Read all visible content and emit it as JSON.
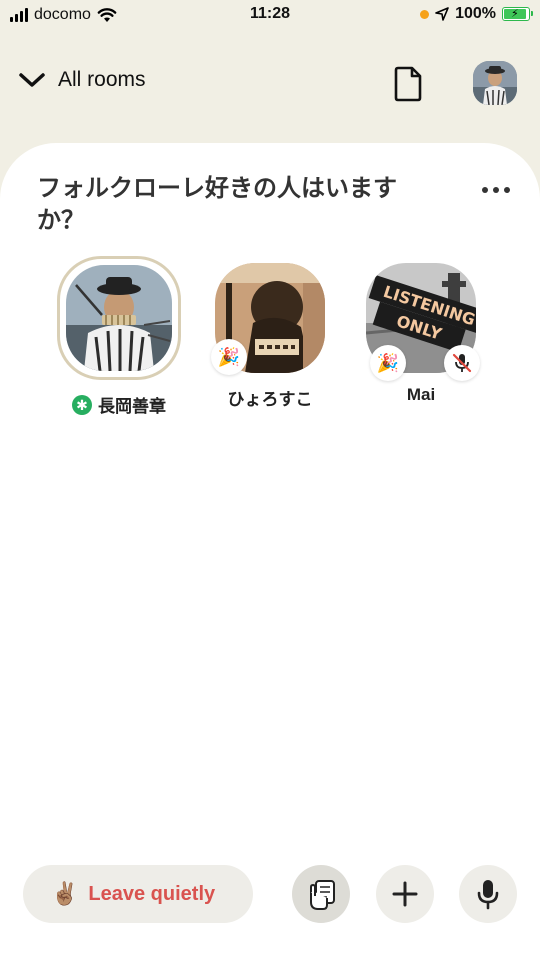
{
  "status_bar": {
    "carrier": "docomo",
    "time": "11:28",
    "battery": "100%"
  },
  "header": {
    "back_label": "All rooms",
    "icons": [
      "chevron-down-icon",
      "document-icon",
      "avatar"
    ]
  },
  "room": {
    "title": "フォルクローレ好きの人はいますか？",
    "speakers": [
      {
        "name": "長岡善章",
        "moderator": true,
        "speaking": true
      },
      {
        "name": "ひょろすこ",
        "badge": "party-popper-icon"
      },
      {
        "name": "Mai",
        "badge": "party-popper-icon",
        "muted": true,
        "avatar_text": [
          "LISTENING",
          "ONLY"
        ]
      }
    ]
  },
  "bottom": {
    "leave_emoji": "✌🏽",
    "leave_label": "Leave quietly",
    "icons": [
      "raise-hand-icon",
      "plus-icon",
      "microphone-icon"
    ]
  },
  "colors": {
    "background": "#f1efe4",
    "leave_text": "#d9534f",
    "moderator_badge": "#27ae60"
  }
}
